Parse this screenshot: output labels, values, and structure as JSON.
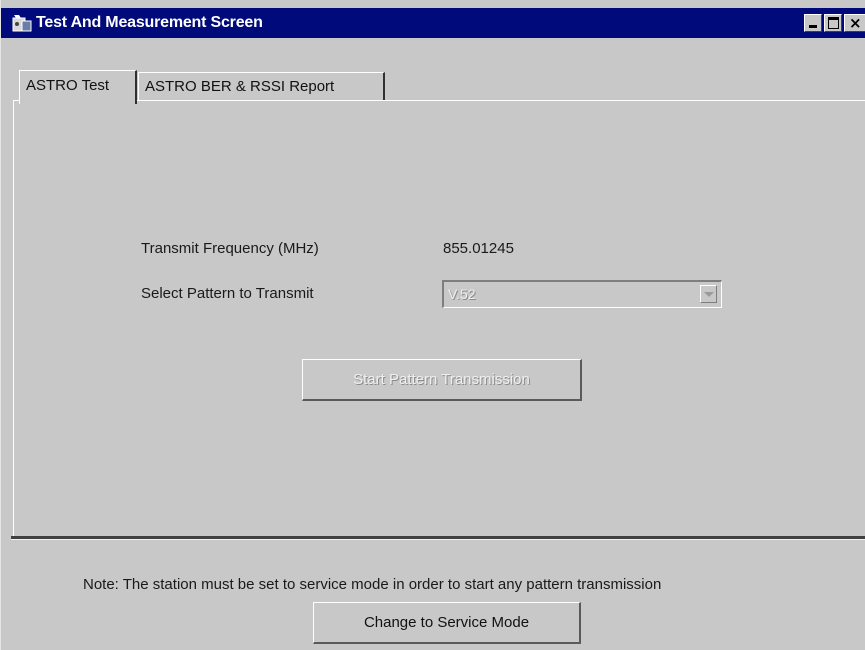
{
  "window": {
    "title": "Test And Measurement Screen",
    "titlebar_color": "#000a7a",
    "icon": "app-icon",
    "controls": {
      "minimize": "minimize-icon",
      "maximize": "maximize-icon",
      "close": "×"
    }
  },
  "tabs": [
    {
      "label": "ASTRO Test",
      "active": true
    },
    {
      "label": "ASTRO BER & RSSI Report",
      "active": false
    }
  ],
  "form": {
    "frequency_label": "Transmit Frequency (MHz)",
    "frequency_value": "855.01245",
    "pattern_label": "Select Pattern to Transmit",
    "pattern_selected": "V.52",
    "pattern_disabled": true,
    "start_button_label": "Start Pattern Transmission",
    "start_button_disabled": true
  },
  "footer": {
    "note": "Note: The station must be set to service mode in order to start any pattern transmission",
    "service_button_label": "Change to Service Mode"
  }
}
